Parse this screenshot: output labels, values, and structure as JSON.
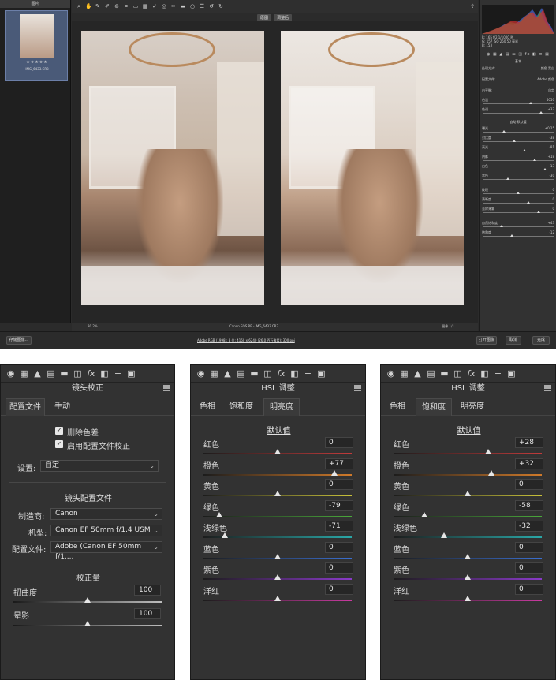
{
  "acr": {
    "filmstrip": {
      "header": "图片",
      "stars": "★★★★★",
      "filename": "IMG_6433.CR3"
    },
    "compare": {
      "before": "原图",
      "after": "调整后"
    },
    "status": {
      "zoom": "30.2%",
      "filename": "Canon EOS RP - IMG_6433.CR3",
      "count": "图像 1/1"
    },
    "readout": {
      "line1": "R: 165    f/2   1/1000 秒",
      "line2": "G: 157   ISO 250   50 毫米",
      "line3": "B: 153"
    },
    "panel_title": "基本",
    "sliders": [
      {
        "label": "处理方式:",
        "value": "颜色  黑白"
      },
      {
        "label": "配置文件:",
        "value": "Adobe 颜色"
      },
      {
        "label": "白平衡:",
        "value": "自定"
      },
      {
        "label": "色温",
        "value": "5050"
      },
      {
        "label": "色调",
        "value": "+37"
      },
      {
        "label": "曝光",
        "value": "+0.25"
      },
      {
        "label": "对比度",
        "value": "-38"
      },
      {
        "label": "高光",
        "value": "-81"
      },
      {
        "label": "阴影",
        "value": "+18"
      },
      {
        "label": "白色",
        "value": "-13"
      },
      {
        "label": "黑色",
        "value": "-30"
      },
      {
        "label": "纹理",
        "value": "0"
      },
      {
        "label": "清晰度",
        "value": "0"
      },
      {
        "label": "去除薄雾",
        "value": "0"
      },
      {
        "label": "自然饱和度",
        "value": "+43"
      },
      {
        "label": "饱和度",
        "value": "-12"
      }
    ],
    "auto_default": "自动    默认值",
    "buttons": {
      "save": "存储图像...",
      "open": "打开图像",
      "cancel": "取消",
      "done": "完成"
    },
    "workflow": "Adobe RGB (1998); 8 位; 4160 x 6240 (26.0 百万像素); 300 ppi"
  },
  "lens_panel": {
    "title": "镜头校正",
    "tabs": [
      "配置文件",
      "手动"
    ],
    "checkbox_ca": "删除色差",
    "checkbox_profile": "启用配置文件校正",
    "setup_label": "设置:",
    "setup_value": "自定",
    "profile_section": "镜头配置文件",
    "make_label": "制造商:",
    "make_value": "Canon",
    "model_label": "机型:",
    "model_value": "Canon EF 50mm f/1.4 USM",
    "profile_label": "配置文件:",
    "profile_value": "Adobe (Canon EF 50mm f/1....",
    "amount_section": "校正量",
    "distortion_label": "扭曲度",
    "distortion_value": "100",
    "vignette_label": "晕影",
    "vignette_value": "100"
  },
  "hsl_panel_1": {
    "title": "HSL 调整",
    "tabs": [
      "色相",
      "饱和度",
      "明亮度"
    ],
    "default_link": "默认值",
    "rows": [
      {
        "label": "红色",
        "value": "0",
        "level": 0
      },
      {
        "label": "橙色",
        "value": "+77",
        "level": 77
      },
      {
        "label": "黄色",
        "value": "0",
        "level": 0
      },
      {
        "label": "绿色",
        "value": "-79",
        "level": -79
      },
      {
        "label": "浅绿色",
        "value": "-71",
        "level": -71
      },
      {
        "label": "蓝色",
        "value": "0",
        "level": 0
      },
      {
        "label": "紫色",
        "value": "0",
        "level": 0
      },
      {
        "label": "洋红",
        "value": "0",
        "level": 0
      }
    ]
  },
  "hsl_panel_2": {
    "title": "HSL 调整",
    "tabs": [
      "色相",
      "饱和度",
      "明亮度"
    ],
    "default_link": "默认值",
    "rows": [
      {
        "label": "红色",
        "value": "+28",
        "level": 28
      },
      {
        "label": "橙色",
        "value": "+32",
        "level": 32
      },
      {
        "label": "黄色",
        "value": "0",
        "level": 0
      },
      {
        "label": "绿色",
        "value": "-58",
        "level": -58
      },
      {
        "label": "浅绿色",
        "value": "-32",
        "level": -32
      },
      {
        "label": "蓝色",
        "value": "0",
        "level": 0
      },
      {
        "label": "紫色",
        "value": "0",
        "level": 0
      },
      {
        "label": "洋红",
        "value": "0",
        "level": 0
      }
    ]
  },
  "track_colors": [
    "#c23b3b",
    "#d07a2a",
    "#c9c23a",
    "#4aa83b",
    "#2aa8a8",
    "#3a6fd0",
    "#8a3ac9",
    "#c93aa0"
  ],
  "panel_icons": [
    "aperture-icon",
    "grid-icon",
    "mountain-icon",
    "hsl-icon",
    "split-tone-icon",
    "lens-icon",
    "fx-icon",
    "camera-calibration-icon",
    "presets-icon",
    "snapshots-icon"
  ]
}
